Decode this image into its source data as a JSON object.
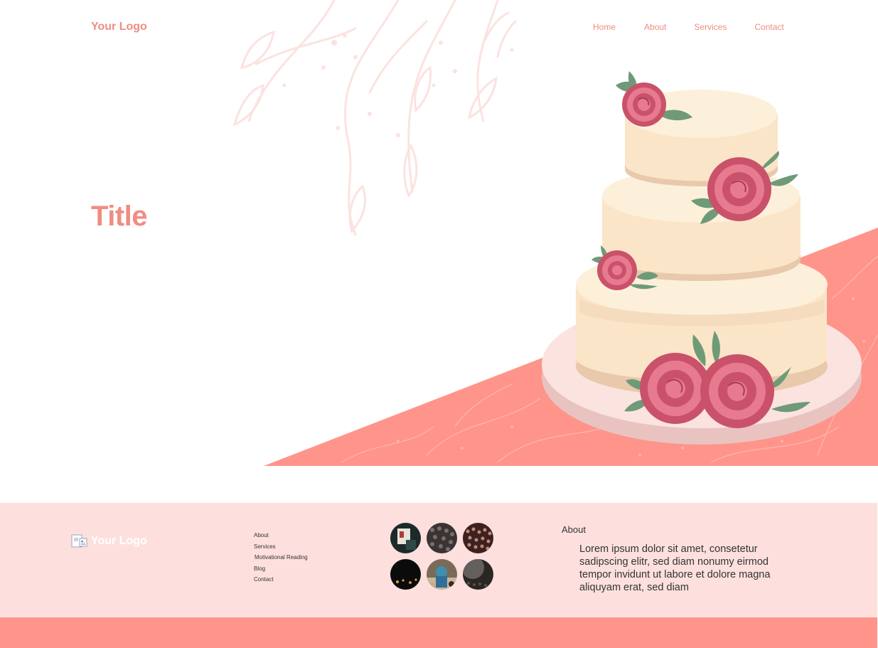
{
  "header": {
    "logo": "Your Logo",
    "nav": [
      "Home",
      "About",
      "Services",
      "Contact"
    ]
  },
  "hero": {
    "title": "Title"
  },
  "footer": {
    "logo": "Your Logo",
    "links": [
      "About",
      "Services",
      "Motivational Reading",
      "Blog",
      "Contact"
    ],
    "gallery_count": 6,
    "about_title": "About",
    "about_text": "Lorem ipsum dolor sit amet, consetetur sadipscing elitr, sed diam nonumy eirmod tempor invidunt ut labore et dolore magna aliquyam erat, sed diam"
  },
  "colors": {
    "accent": "#f08c82",
    "salmon": "#ff948a",
    "footer_bg": "#fde0dd",
    "cake": "#fbe5c8",
    "rose": "#c9526a",
    "leaf": "#6f9a78"
  }
}
